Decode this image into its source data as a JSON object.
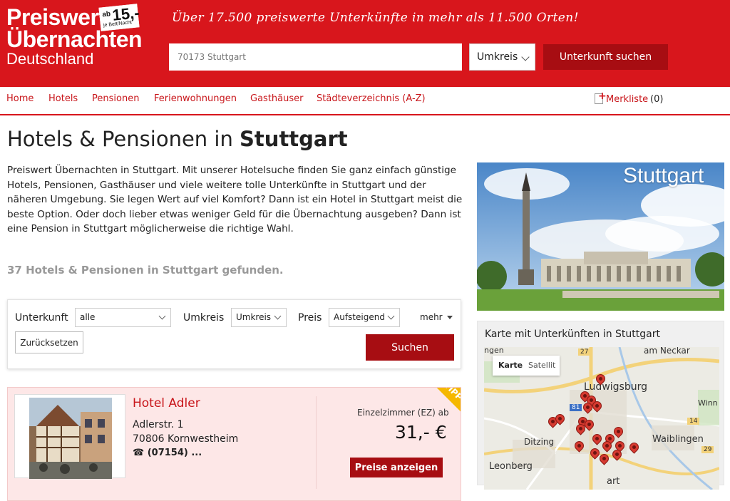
{
  "header": {
    "logo": {
      "line1": "Preiswert",
      "line2": "Übernachten",
      "line3": "Deutschland"
    },
    "badge": {
      "ab": "ab",
      "price": "15,-",
      "unit": "je Bett/Nacht"
    },
    "tagline": "Über 17.500 preiswerte Unterkünfte in mehr als 11.500 Orten!",
    "search_value": "70173 Stuttgart",
    "radius_label": "Umkreis",
    "search_button": "Unterkunft suchen",
    "colors": {
      "brand": "#d8161c",
      "button": "#a70d12"
    }
  },
  "nav": {
    "items": [
      "Home",
      "Hotels",
      "Pensionen",
      "Ferienwohnungen",
      "Gasthäuser",
      "Städteverzeichnis (A-Z)"
    ],
    "merkliste": "Merkliste",
    "merkliste_count": "(0)"
  },
  "main": {
    "title_prefix": "Hotels & Pensionen in ",
    "title_city": "Stuttgart",
    "intro": "Preiswert Übernachten in Stuttgart. Mit unserer Hotelsuche finden Sie ganz einfach günstige Hotels, Pensionen, Gasthäuser und viele weitere tolle Unterkünfte in Stuttgart und der näheren Umgebung. Sie legen Wert auf viel Komfort? Dann ist ein Hotel in Stuttgart meist die beste Option. Oder doch lieber etwas weniger Geld für die Übernachtung ausgeben? Dann ist eine Pension in Stuttgart möglicherweise die richtige Wahl.",
    "found": "37 Hotels & Pensionen in Stuttgart gefunden."
  },
  "filter": {
    "unterkunft_label": "Unterkunft",
    "unterkunft_value": "alle",
    "umkreis_label": "Umkreis",
    "umkreis_value": "Umkreis",
    "preis_label": "Preis",
    "preis_value": "Aufsteigend",
    "mehr": "mehr",
    "reset": "Zurücksetzen",
    "submit": "Suchen"
  },
  "results": [
    {
      "name": "Hotel Adler",
      "street": "Adlerstr. 1",
      "city": "70806 Kornwestheim",
      "phone": "☎ (07154) ...",
      "room_type": "Einzelzimmer (EZ) ab",
      "price": "31,- €",
      "button": "Preise anzeigen",
      "badge": "TIPP"
    }
  ],
  "sidebar": {
    "city_label": "Stuttgart",
    "map_title": "Karte mit Unterkünften in Stuttgart",
    "map_types": [
      "Karte",
      "Satellit"
    ],
    "map_places": [
      "ngen",
      "am Neckar",
      "Ludwigsburg",
      "Winn",
      "Ditzing",
      "Waiblingen",
      "Leonberg",
      "art"
    ],
    "road_numbers": [
      "27",
      "81",
      "14",
      "29"
    ]
  }
}
